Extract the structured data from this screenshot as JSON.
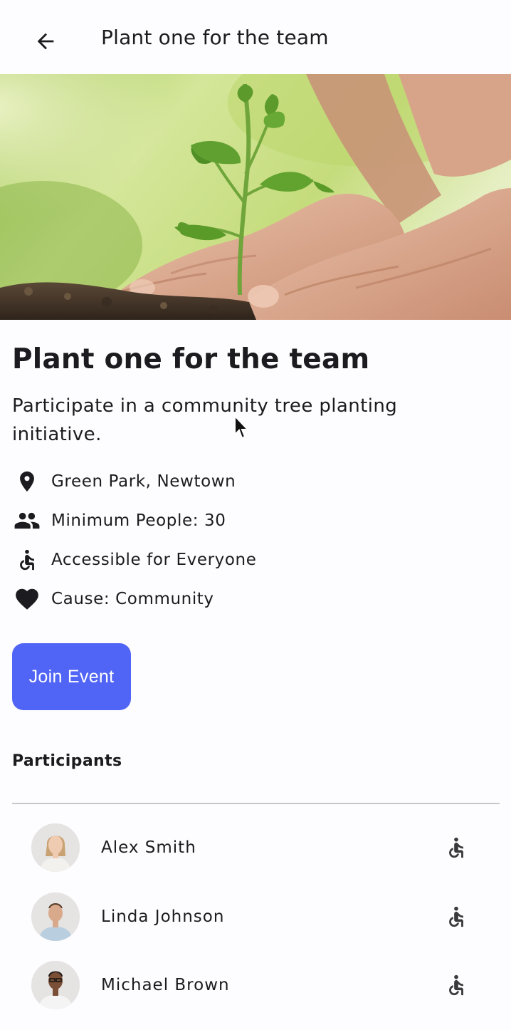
{
  "appbar": {
    "title": "Plant one for the team",
    "back_icon": "arrow-left-icon"
  },
  "hero": {
    "subject": "seedling planted by hands in soil",
    "colors": {
      "bg_light": "#dbe9a6",
      "bg_green": "#8fbf3a",
      "soil": "#4a3a2c",
      "skin": "#e2b39a",
      "leaf": "#5c9a2c"
    }
  },
  "event": {
    "title": "Plant one for the team",
    "description": "Participate in a community tree planting initiative.",
    "details": [
      {
        "icon": "location-pin-icon",
        "text": "Green Park, Newtown"
      },
      {
        "icon": "group-icon",
        "text": "Minimum People: 30"
      },
      {
        "icon": "accessible-icon",
        "text": "Accessible for Everyone"
      },
      {
        "icon": "heart-icon",
        "text": "Cause: Community"
      }
    ],
    "join_label": "Join Event",
    "accent": "#5064f5"
  },
  "participants": {
    "heading": "Participants",
    "items": [
      {
        "name": "Alex Smith",
        "status_icon": "accessible-icon"
      },
      {
        "name": "Linda Johnson",
        "status_icon": "accessible-icon"
      },
      {
        "name": "Michael Brown",
        "status_icon": "accessible-icon"
      }
    ]
  }
}
